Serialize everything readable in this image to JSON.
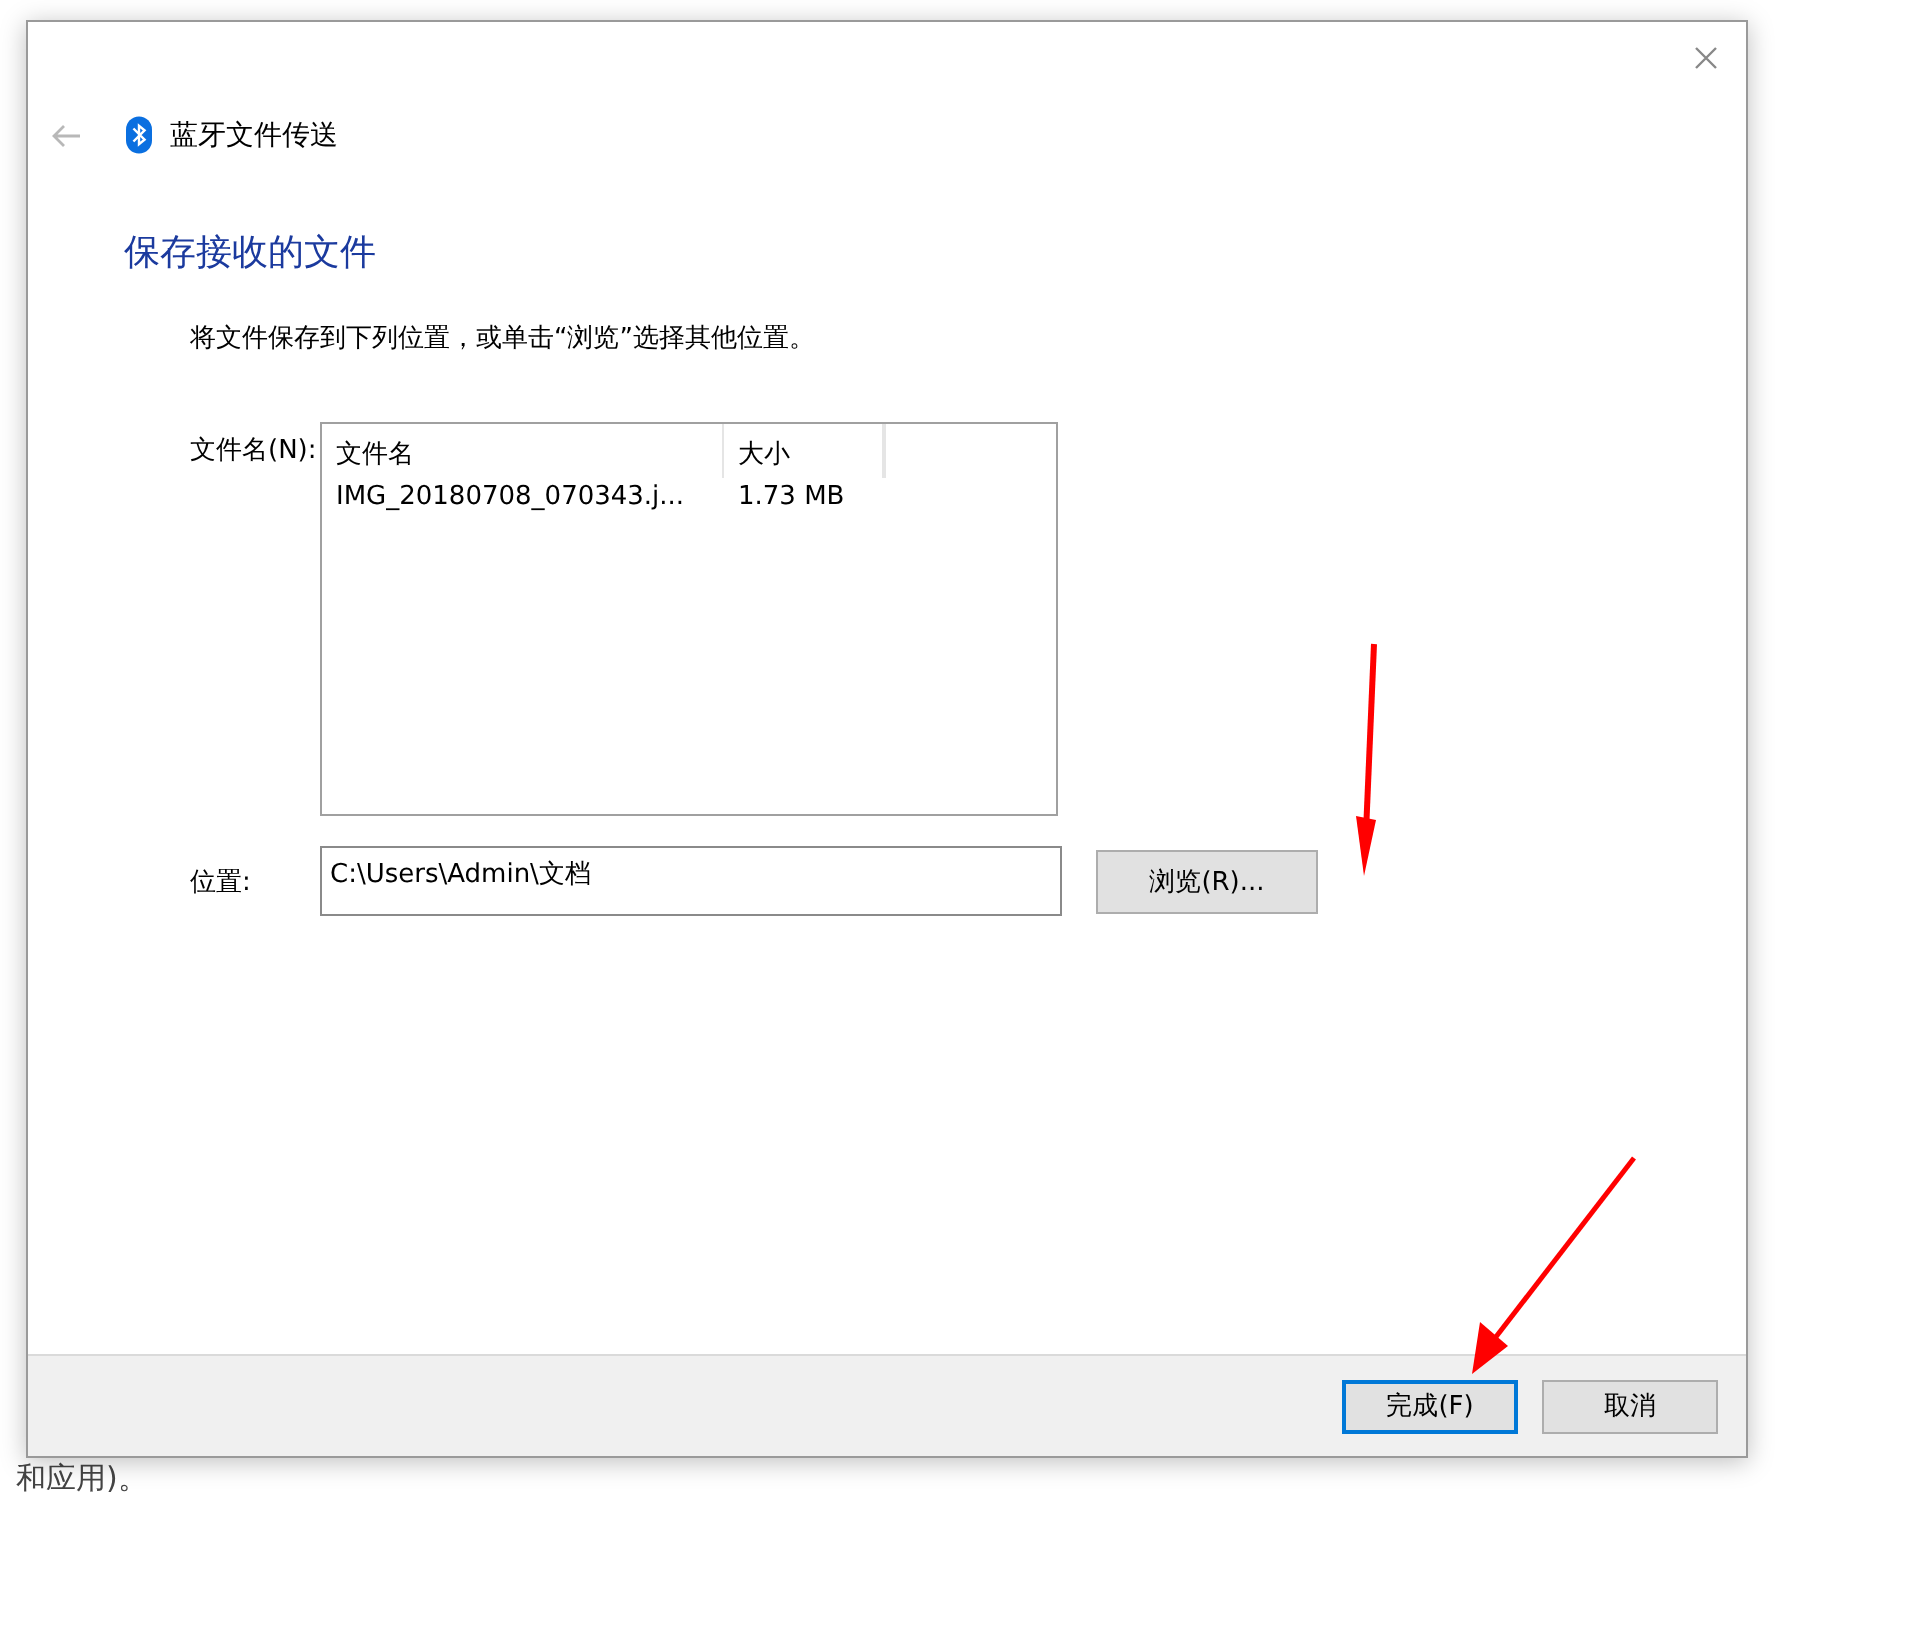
{
  "background_page": {
    "fragments": [
      {
        "text": "和应用)。"
      }
    ]
  },
  "dialog": {
    "title": "蓝牙文件传送",
    "heading": "保存接收的文件",
    "description": "将文件保存到下列位置，或单击“浏览”选择其他位置。",
    "file_label": "文件名(N):",
    "file_list": {
      "columns": [
        "文件名",
        "大小"
      ],
      "rows": [
        {
          "name": "IMG_20180708_070343.j...",
          "size": "1.73 MB",
          "selected": false
        }
      ]
    },
    "location_label": "位置:",
    "location_value": "C:\\Users\\Admin\\文档",
    "browse_button": "浏览(R)...",
    "buttons": [
      {
        "label": "完成(F)",
        "default": true
      },
      {
        "label": "取消",
        "default": false
      }
    ]
  }
}
